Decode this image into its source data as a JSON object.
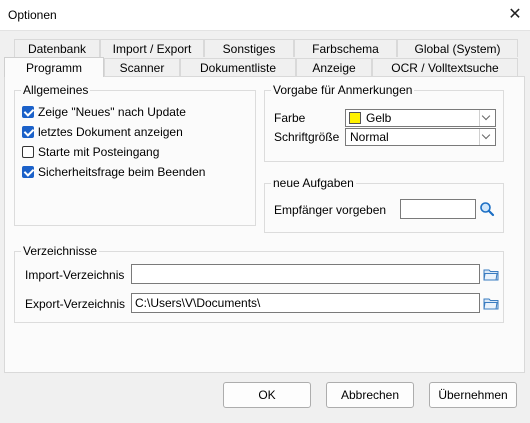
{
  "window": {
    "title": "Optionen",
    "close_glyph": "✕"
  },
  "tabs_row1": [
    {
      "label": "Datenbank"
    },
    {
      "label": "Import / Export"
    },
    {
      "label": "Sonstiges"
    },
    {
      "label": "Farbschema"
    },
    {
      "label": "Global (System)"
    }
  ],
  "tabs_row2": [
    {
      "label": "Programm",
      "active": true
    },
    {
      "label": "Scanner"
    },
    {
      "label": "Dokumentliste"
    },
    {
      "label": "Anzeige"
    },
    {
      "label": "OCR / Volltextsuche"
    }
  ],
  "allgemeines": {
    "legend": "Allgemeines",
    "options": [
      {
        "label": "Zeige \"Neues\" nach Update",
        "checked": true
      },
      {
        "label": "letztes Dokument anzeigen",
        "checked": true
      },
      {
        "label": "Starte mit Posteingang",
        "checked": false
      },
      {
        "label": "Sicherheitsfrage beim Beenden",
        "checked": true
      }
    ]
  },
  "anmerkungen": {
    "legend": "Vorgabe für Anmerkungen",
    "farbe_label": "Farbe",
    "farbe_value": "Gelb",
    "farbe_color": "#fff200",
    "schrift_label": "Schriftgröße",
    "schrift_value": "Normal"
  },
  "aufgaben": {
    "legend": "neue Aufgaben",
    "empfaenger_label": "Empfänger vorgeben",
    "empfaenger_value": ""
  },
  "verzeichnisse": {
    "legend": "Verzeichnisse",
    "import_label": "Import-Verzeichnis",
    "import_value": "",
    "export_label": "Export-Verzeichnis",
    "export_value": "C:\\Users\\V\\Documents\\"
  },
  "buttons": {
    "ok": "OK",
    "cancel": "Abbrechen",
    "apply": "Übernehmen"
  },
  "colors": {
    "accent": "#1b61c9"
  }
}
